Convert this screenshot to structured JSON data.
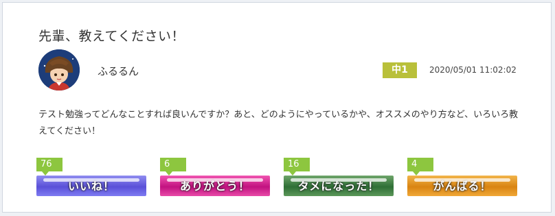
{
  "post": {
    "title": "先輩、教えてください！",
    "username": "ふるるん",
    "grade": "中1",
    "datetime": "2020/05/01 11:02:02",
    "body": "テスト勉強ってどんなことすれば良いんですか？あと、どのようにやっているかや、オススメのやり方など、いろいろ教えてください！"
  },
  "reactions": [
    {
      "count": "76",
      "label": "いいね！",
      "color": "#5a50d8"
    },
    {
      "count": "6",
      "label": "ありがとう！",
      "color": "#c21280"
    },
    {
      "count": "16",
      "label": "タメになった！",
      "color": "#2f6f36"
    },
    {
      "count": "4",
      "label": "がんばる！",
      "color": "#d98412"
    }
  ],
  "colors": {
    "grade_badge": "#b9c03a",
    "count_badge": "#8dc63f"
  },
  "icons": {
    "avatar": "girl-avatar-icon"
  }
}
